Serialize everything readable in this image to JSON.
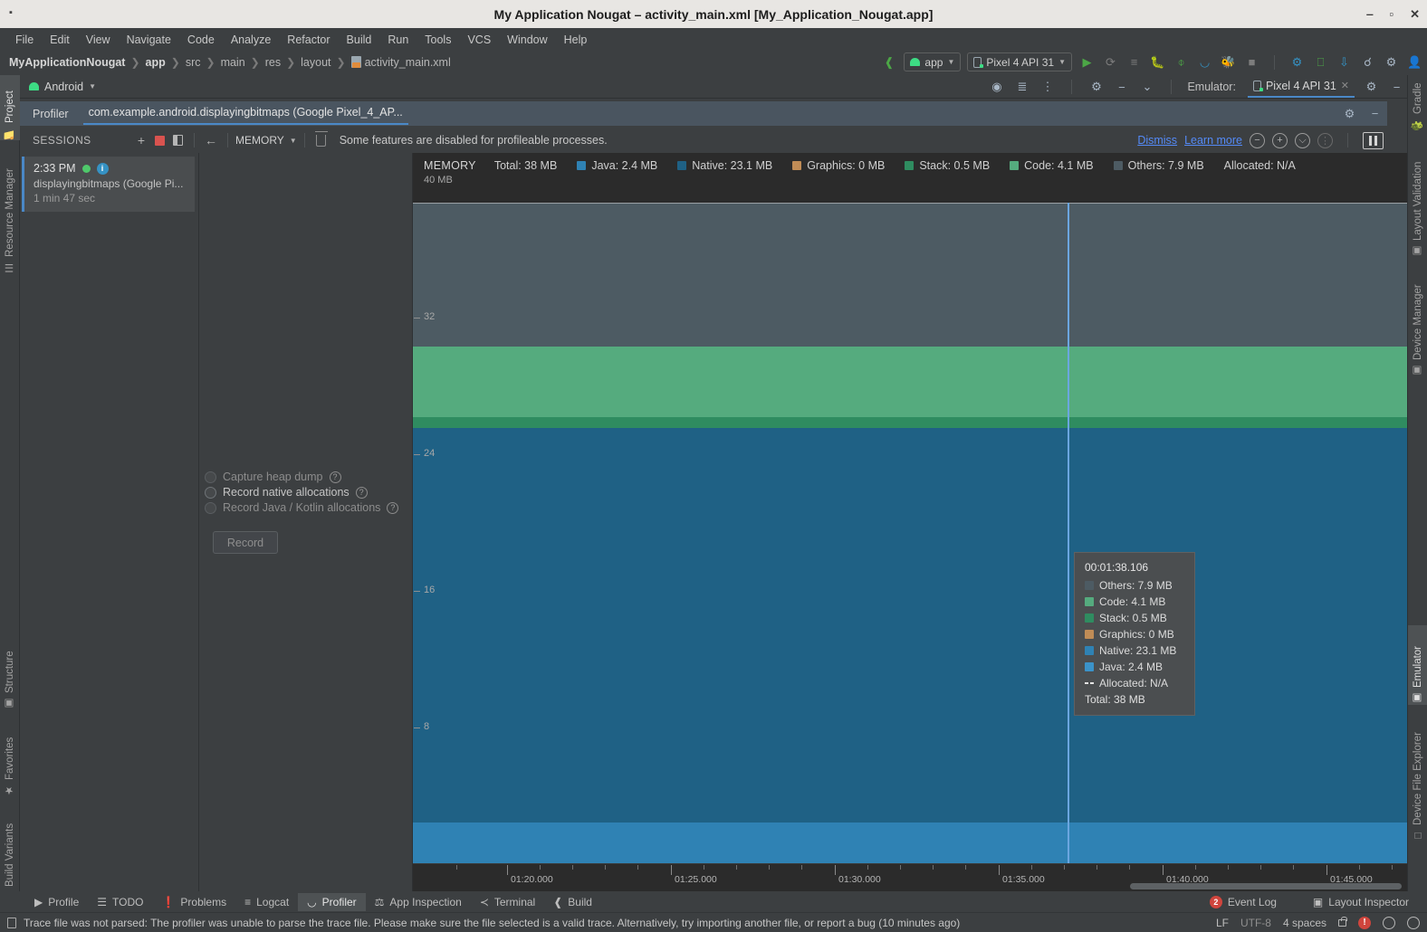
{
  "window": {
    "title": "My Application Nougat – activity_main.xml [My_Application_Nougat.app]",
    "minimize": "‒",
    "maximize": "▫",
    "close": "✕"
  },
  "menu": [
    "File",
    "Edit",
    "View",
    "Navigate",
    "Code",
    "Analyze",
    "Refactor",
    "Build",
    "Run",
    "Tools",
    "VCS",
    "Window",
    "Help"
  ],
  "breadcrumb": {
    "items": [
      "MyApplicationNougat",
      "app",
      "src",
      "main",
      "res",
      "layout",
      "activity_main.xml"
    ],
    "separator": "❯"
  },
  "toolbar": {
    "build_hammer": "build-icon",
    "run_config": "app",
    "device": "Pixel 4 API 31",
    "run": "▶",
    "apply_changes": "run-icon",
    "debug": "debug-icon",
    "search": "⌕",
    "settings": "⚙"
  },
  "android_tab": {
    "label": "Android",
    "emulator_label": "Emulator:",
    "emulator_tab": "Pixel 4 API 31",
    "close": "✕"
  },
  "profiler_header": {
    "title": "Profiler",
    "process": "com.example.android.displayingbitmaps (Google Pixel_4_AP..."
  },
  "sessions_toolbar": {
    "title": "SESSIONS",
    "add": "+",
    "stop": "stop-icon",
    "panel": "panel-icon",
    "back": "←",
    "stage": "MEMORY",
    "trash": "trash-icon",
    "banner": "Some features are disabled for profileable processes.",
    "dismiss": "Dismiss",
    "learn_more": "Learn more",
    "zoom_out": "−",
    "zoom_in": "+",
    "reset_zoom": "⦸",
    "jump_live": "⦙⦙",
    "pause": "pause-icon"
  },
  "sessions": [
    {
      "time": "2:33 PM",
      "name": "displayingbitmaps (Google Pi...",
      "duration": "1 min 47 sec",
      "status": "running",
      "info": "i"
    }
  ],
  "record_options": {
    "items": [
      {
        "label": "Capture heap dump",
        "enabled": false,
        "help": "?"
      },
      {
        "label": "Record native allocations",
        "enabled": true,
        "help": "?"
      },
      {
        "label": "Record Java / Kotlin allocations",
        "enabled": false,
        "help": "?"
      }
    ],
    "record_button": "Record"
  },
  "chart_data": {
    "type": "area",
    "title": "MEMORY",
    "total_label": "Total: 38 MB",
    "allocated_label": "Allocated: N/A",
    "ylabel": "MB",
    "ylim": [
      0,
      40
    ],
    "ytop_label": "40 MB",
    "yticks": [
      32,
      24,
      16,
      8
    ],
    "xlabel": "",
    "xticks": [
      "01:20.000",
      "01:25.000",
      "01:30.000",
      "01:35.000",
      "01:40.000",
      "01:45.000"
    ],
    "legend_position": "top",
    "grid": false,
    "stacked": true,
    "cursor_time": "00:01:38.106",
    "series": [
      {
        "name": "Java",
        "value": 2.4,
        "unit": "MB",
        "color": "#2f82b4",
        "label": "Java: 2.4 MB"
      },
      {
        "name": "Native",
        "value": 23.1,
        "unit": "MB",
        "color": "#1f6185",
        "label": "Native: 23.1 MB"
      },
      {
        "name": "Graphics",
        "value": 0,
        "unit": "MB",
        "color": "#c08c56",
        "label": "Graphics: 0 MB"
      },
      {
        "name": "Stack",
        "value": 0.5,
        "unit": "MB",
        "color": "#2f8c60",
        "label": "Stack: 0.5 MB"
      },
      {
        "name": "Code",
        "value": 4.1,
        "unit": "MB",
        "color": "#55ab7e",
        "label": "Code: 4.1 MB"
      },
      {
        "name": "Others",
        "value": 7.9,
        "unit": "MB",
        "color": "#4d5b63",
        "label": "Others: 7.9 MB"
      }
    ],
    "total": 38,
    "allocated": "N/A"
  },
  "tooltip": {
    "time": "00:01:38.106",
    "rows": [
      {
        "label": "Others: 7.9 MB",
        "color": "#4d5b63"
      },
      {
        "label": "Code: 4.1 MB",
        "color": "#55ab7e"
      },
      {
        "label": "Stack: 0.5 MB",
        "color": "#2f8c60"
      },
      {
        "label": "Graphics: 0 MB",
        "color": "#c08c56"
      },
      {
        "label": "Native: 23.1 MB",
        "color": "#2f82b4"
      },
      {
        "label": "Java: 2.4 MB",
        "color": "#3b93c9"
      }
    ],
    "allocated": "Allocated: N/A",
    "total": "Total: 38 MB"
  },
  "left_tools": [
    "Project",
    "Resource Manager",
    "Structure",
    "Favorites",
    "Build Variants"
  ],
  "right_tools": [
    "Gradle",
    "Layout Validation",
    "Device Manager",
    "Emulator",
    "Device File Explorer"
  ],
  "bottom_tools": [
    {
      "label": "Profile",
      "icon": "play-icon",
      "selected": false
    },
    {
      "label": "TODO",
      "icon": "list-icon",
      "selected": false
    },
    {
      "label": "Problems",
      "icon": "warning-icon",
      "selected": false
    },
    {
      "label": "Logcat",
      "icon": "logcat-icon",
      "selected": false
    },
    {
      "label": "Profiler",
      "icon": "profiler-icon",
      "selected": true
    },
    {
      "label": "App Inspection",
      "icon": "inspect-icon",
      "selected": false
    },
    {
      "label": "Terminal",
      "icon": "terminal-icon",
      "selected": false
    },
    {
      "label": "Build",
      "icon": "hammer-icon",
      "selected": false
    }
  ],
  "bottom_right": {
    "event_log": "Event Log",
    "event_log_count": "2",
    "layout_inspector": "Layout Inspector"
  },
  "statusbar": {
    "message": "Trace file was not parsed: The profiler was unable to parse the trace file. Please make sure the file selected is a valid trace. Alternatively, try importing another file, or report a bug (10 minutes ago)",
    "line_sep": "LF",
    "encoding": "UTF-8",
    "indent": "4 spaces"
  },
  "colors": {
    "accent": "#4a88c7",
    "cursor": "#6ba6e0",
    "link": "#548af7",
    "error": "#d0453d",
    "success": "#4fc96b"
  }
}
